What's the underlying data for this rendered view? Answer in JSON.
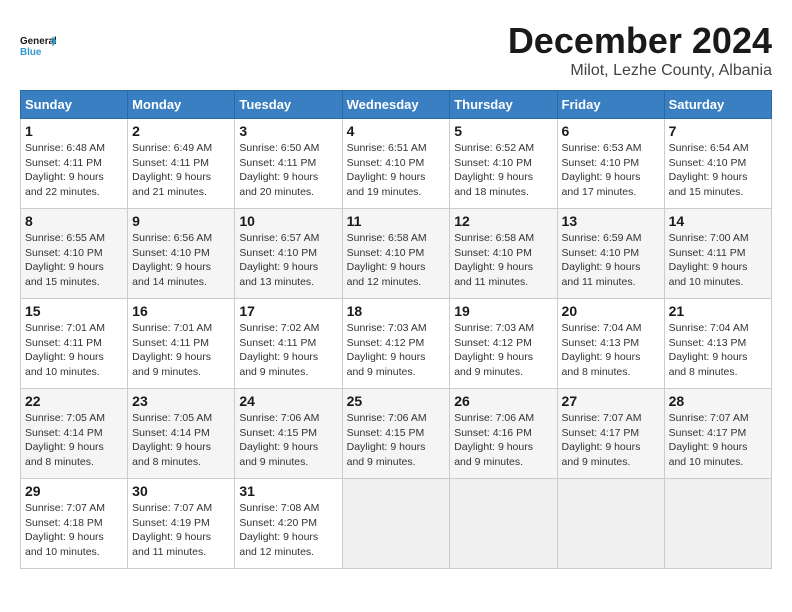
{
  "header": {
    "logo_general": "General",
    "logo_blue": "Blue",
    "month": "December 2024",
    "location": "Milot, Lezhe County, Albania"
  },
  "weekdays": [
    "Sunday",
    "Monday",
    "Tuesday",
    "Wednesday",
    "Thursday",
    "Friday",
    "Saturday"
  ],
  "weeks": [
    [
      {
        "day": "1",
        "sunrise": "6:48 AM",
        "sunset": "4:11 PM",
        "daylight": "9 hours and 22 minutes."
      },
      {
        "day": "2",
        "sunrise": "6:49 AM",
        "sunset": "4:11 PM",
        "daylight": "9 hours and 21 minutes."
      },
      {
        "day": "3",
        "sunrise": "6:50 AM",
        "sunset": "4:11 PM",
        "daylight": "9 hours and 20 minutes."
      },
      {
        "day": "4",
        "sunrise": "6:51 AM",
        "sunset": "4:10 PM",
        "daylight": "9 hours and 19 minutes."
      },
      {
        "day": "5",
        "sunrise": "6:52 AM",
        "sunset": "4:10 PM",
        "daylight": "9 hours and 18 minutes."
      },
      {
        "day": "6",
        "sunrise": "6:53 AM",
        "sunset": "4:10 PM",
        "daylight": "9 hours and 17 minutes."
      },
      {
        "day": "7",
        "sunrise": "6:54 AM",
        "sunset": "4:10 PM",
        "daylight": "9 hours and 15 minutes."
      }
    ],
    [
      {
        "day": "8",
        "sunrise": "6:55 AM",
        "sunset": "4:10 PM",
        "daylight": "9 hours and 15 minutes."
      },
      {
        "day": "9",
        "sunrise": "6:56 AM",
        "sunset": "4:10 PM",
        "daylight": "9 hours and 14 minutes."
      },
      {
        "day": "10",
        "sunrise": "6:57 AM",
        "sunset": "4:10 PM",
        "daylight": "9 hours and 13 minutes."
      },
      {
        "day": "11",
        "sunrise": "6:58 AM",
        "sunset": "4:10 PM",
        "daylight": "9 hours and 12 minutes."
      },
      {
        "day": "12",
        "sunrise": "6:58 AM",
        "sunset": "4:10 PM",
        "daylight": "9 hours and 11 minutes."
      },
      {
        "day": "13",
        "sunrise": "6:59 AM",
        "sunset": "4:10 PM",
        "daylight": "9 hours and 11 minutes."
      },
      {
        "day": "14",
        "sunrise": "7:00 AM",
        "sunset": "4:11 PM",
        "daylight": "9 hours and 10 minutes."
      }
    ],
    [
      {
        "day": "15",
        "sunrise": "7:01 AM",
        "sunset": "4:11 PM",
        "daylight": "9 hours and 10 minutes."
      },
      {
        "day": "16",
        "sunrise": "7:01 AM",
        "sunset": "4:11 PM",
        "daylight": "9 hours and 9 minutes."
      },
      {
        "day": "17",
        "sunrise": "7:02 AM",
        "sunset": "4:11 PM",
        "daylight": "9 hours and 9 minutes."
      },
      {
        "day": "18",
        "sunrise": "7:03 AM",
        "sunset": "4:12 PM",
        "daylight": "9 hours and 9 minutes."
      },
      {
        "day": "19",
        "sunrise": "7:03 AM",
        "sunset": "4:12 PM",
        "daylight": "9 hours and 9 minutes."
      },
      {
        "day": "20",
        "sunrise": "7:04 AM",
        "sunset": "4:13 PM",
        "daylight": "9 hours and 8 minutes."
      },
      {
        "day": "21",
        "sunrise": "7:04 AM",
        "sunset": "4:13 PM",
        "daylight": "9 hours and 8 minutes."
      }
    ],
    [
      {
        "day": "22",
        "sunrise": "7:05 AM",
        "sunset": "4:14 PM",
        "daylight": "9 hours and 8 minutes."
      },
      {
        "day": "23",
        "sunrise": "7:05 AM",
        "sunset": "4:14 PM",
        "daylight": "9 hours and 8 minutes."
      },
      {
        "day": "24",
        "sunrise": "7:06 AM",
        "sunset": "4:15 PM",
        "daylight": "9 hours and 9 minutes."
      },
      {
        "day": "25",
        "sunrise": "7:06 AM",
        "sunset": "4:15 PM",
        "daylight": "9 hours and 9 minutes."
      },
      {
        "day": "26",
        "sunrise": "7:06 AM",
        "sunset": "4:16 PM",
        "daylight": "9 hours and 9 minutes."
      },
      {
        "day": "27",
        "sunrise": "7:07 AM",
        "sunset": "4:17 PM",
        "daylight": "9 hours and 9 minutes."
      },
      {
        "day": "28",
        "sunrise": "7:07 AM",
        "sunset": "4:17 PM",
        "daylight": "9 hours and 10 minutes."
      }
    ],
    [
      {
        "day": "29",
        "sunrise": "7:07 AM",
        "sunset": "4:18 PM",
        "daylight": "9 hours and 10 minutes."
      },
      {
        "day": "30",
        "sunrise": "7:07 AM",
        "sunset": "4:19 PM",
        "daylight": "9 hours and 11 minutes."
      },
      {
        "day": "31",
        "sunrise": "7:08 AM",
        "sunset": "4:20 PM",
        "daylight": "9 hours and 12 minutes."
      },
      null,
      null,
      null,
      null
    ]
  ]
}
